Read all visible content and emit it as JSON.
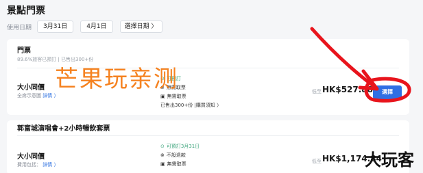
{
  "page": {
    "title": "景點門票"
  },
  "dates": {
    "label": "使用日期",
    "chips": [
      "3月31日",
      "4月1日"
    ],
    "more": "選擇日期 〉"
  },
  "ticket_card": {
    "title": "門票",
    "stats": "89.6%旅客已預訂 | 已售出300+份",
    "option": {
      "name": "大小同價",
      "sub": "全席示意圖",
      "sub_link": "詳情 〉",
      "policies": [
        "可預訂",
        "無需取票",
        "無需取票"
      ],
      "sold": "已售出300+份 | ",
      "notice": "購買須知 〉",
      "price_label": "低至",
      "price": "HK$527.88",
      "button": "選擇"
    }
  },
  "concert_card": {
    "title": "郭富城演唱會+2小時暢飲套票",
    "option": {
      "name": "大小同價",
      "sub": "費用包括：",
      "sub_link": "詳情 〉",
      "policies": [
        "可預訂3月31日",
        "不設退款",
        "無需取票"
      ],
      "price_label": "低至",
      "price": "HK$1,174.84"
    }
  },
  "watermarks": {
    "main": "芒果玩亲测",
    "corner": "大玩客"
  },
  "colors": {
    "accent": "#2f6fe4",
    "success": "#3aa37a",
    "watermark": "#f58220",
    "annotation": "#e8141c"
  },
  "icons": {
    "clock": "clock-icon",
    "refund": "no-refund-icon",
    "ticket": "ticket-icon"
  }
}
